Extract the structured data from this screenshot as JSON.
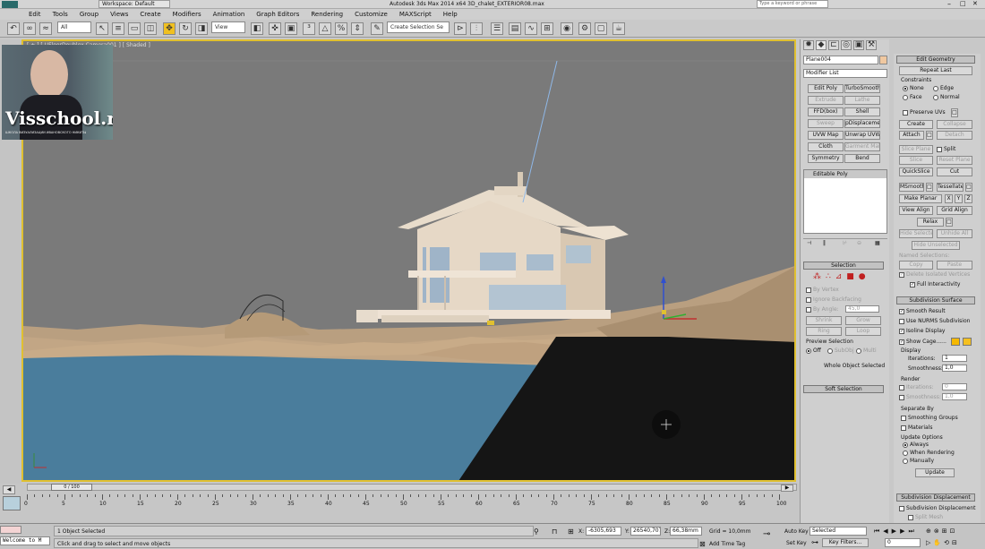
{
  "title_bar": {
    "workspace": "Workspace: Default",
    "app_title": "Autodesk 3ds Max  2014 x64      3D_chalet_EXTERIOR08.max",
    "search_placeholder": "Type a keyword or phrase"
  },
  "menu": [
    "Edit",
    "Tools",
    "Group",
    "Views",
    "Create",
    "Modifiers",
    "Animation",
    "Graph Editors",
    "Rendering",
    "Customize",
    "MAXScript",
    "Help"
  ],
  "toolbar": {
    "filter": "All",
    "ref_coord": "View",
    "selection_set": "Create Selection Se"
  },
  "viewport": {
    "label": "[ + ] [ UFloorDoublex Camera001 ] [ Shaded ]",
    "watermark": "Visschool.ru",
    "watermark_sub": "ШКОЛА ВИЗУАЛИЗАЦИИ ИВАНОВСКОГО НИКИТЫ"
  },
  "command_panel": {
    "object_name": "Plane004",
    "modifier_list": "Modifier List",
    "modifier_buttons": [
      "Edit Poly",
      "TurboSmooth",
      "Extrude",
      "Lathe",
      "FFD(box)",
      "Shell",
      "Sweep",
      "pDisplacement",
      "UVW Map",
      "Unwrap UVW",
      "Cloth",
      "Garment Maker",
      "Symmetry",
      "Bend"
    ],
    "stack_item": "Editable Poly",
    "selection_header": "Selection",
    "by_vertex": "By Vertex",
    "ignore_backfacing": "Ignore Backfacing",
    "by_angle": "By Angle:",
    "by_angle_val": "45,0",
    "shrink": "Shrink",
    "grow": "Grow",
    "ring": "Ring",
    "loop": "Loop",
    "preview_selection": "Preview Selection",
    "preview_off": "Off",
    "preview_subobj": "SubObj",
    "preview_multi": "Multi",
    "whole_object": "Whole Object Selected",
    "soft_selection": "Soft Selection"
  },
  "edit_geometry": {
    "header": "Edit Geometry",
    "repeat_last": "Repeat Last",
    "constraints": "Constraints",
    "c_none": "None",
    "c_edge": "Edge",
    "c_face": "Face",
    "c_normal": "Normal",
    "preserve_uvs": "Preserve UVs",
    "create": "Create",
    "collapse": "Collapse",
    "attach": "Attach",
    "detach": "Detach",
    "slice_plane": "Slice Plane",
    "split": "Split",
    "slice": "Slice",
    "reset_plane": "Reset Plane",
    "quickslice": "QuickSlice",
    "cut": "Cut",
    "msmooth": "MSmooth",
    "tessellate": "Tessellate",
    "make_planar": "Make Planar",
    "x": "X",
    "y": "Y",
    "z": "Z",
    "view_align": "View Align",
    "grid_align": "Grid Align",
    "relax": "Relax",
    "hide_selected": "Hide Selected",
    "unhide_all": "Unhide All",
    "hide_unselected": "Hide Unselected",
    "named_selections": "Named Selections:",
    "copy": "Copy",
    "paste": "Paste",
    "delete_isolated": "Delete Isolated Vertices",
    "full_interactivity": "Full Interactivity"
  },
  "subdivision_surface": {
    "header": "Subdivision Surface",
    "smooth_result": "Smooth Result",
    "use_nurms": "Use NURMS Subdivision",
    "isoline_display": "Isoline Display",
    "show_cage": "Show Cage......",
    "display": "Display",
    "iterations_label": "Iterations:",
    "iterations": "1",
    "smoothness_label": "Smoothness:",
    "smoothness": "1,0",
    "render": "Render",
    "r_iterations": "0",
    "r_smoothness": "1,0",
    "separate_by": "Separate By",
    "smoothing_groups": "Smoothing Groups",
    "materials": "Materials",
    "update_options": "Update Options",
    "always": "Always",
    "when_rendering": "When Rendering",
    "manually": "Manually",
    "update": "Update"
  },
  "subdivision_displacement": {
    "header": "Subdivision Displacement",
    "label": "Subdivision Displacement",
    "split_mesh": "Split Mesh"
  },
  "timeline": {
    "frame": "0 / 100",
    "ticks": [
      "0",
      "5",
      "10",
      "15",
      "20",
      "25",
      "30",
      "35",
      "40",
      "45",
      "50",
      "55",
      "60",
      "65",
      "70",
      "75",
      "80",
      "85",
      "90",
      "95",
      "100"
    ]
  },
  "status": {
    "maxscript": "Welcome to M",
    "selected": "1 Object Selected",
    "prompt": "Click and drag to select and move objects",
    "x_label": "X:",
    "x": "-6305,693",
    "y_label": "Y:",
    "y": "26540,707",
    "z_label": "Z:",
    "z": "66,38mm",
    "grid": "Grid = 10,0mm",
    "add_time_tag": "Add Time Tag",
    "auto_key": "Auto Key",
    "set_key": "Set Key",
    "key_mode": "Selected",
    "key_filters": "Key Filters...",
    "frame_field": "0"
  },
  "colors": {
    "viewport_border": "#e0c030",
    "water": "#4a7d9c",
    "terrain": "#c2a685",
    "sky": "#7a7a7a"
  }
}
